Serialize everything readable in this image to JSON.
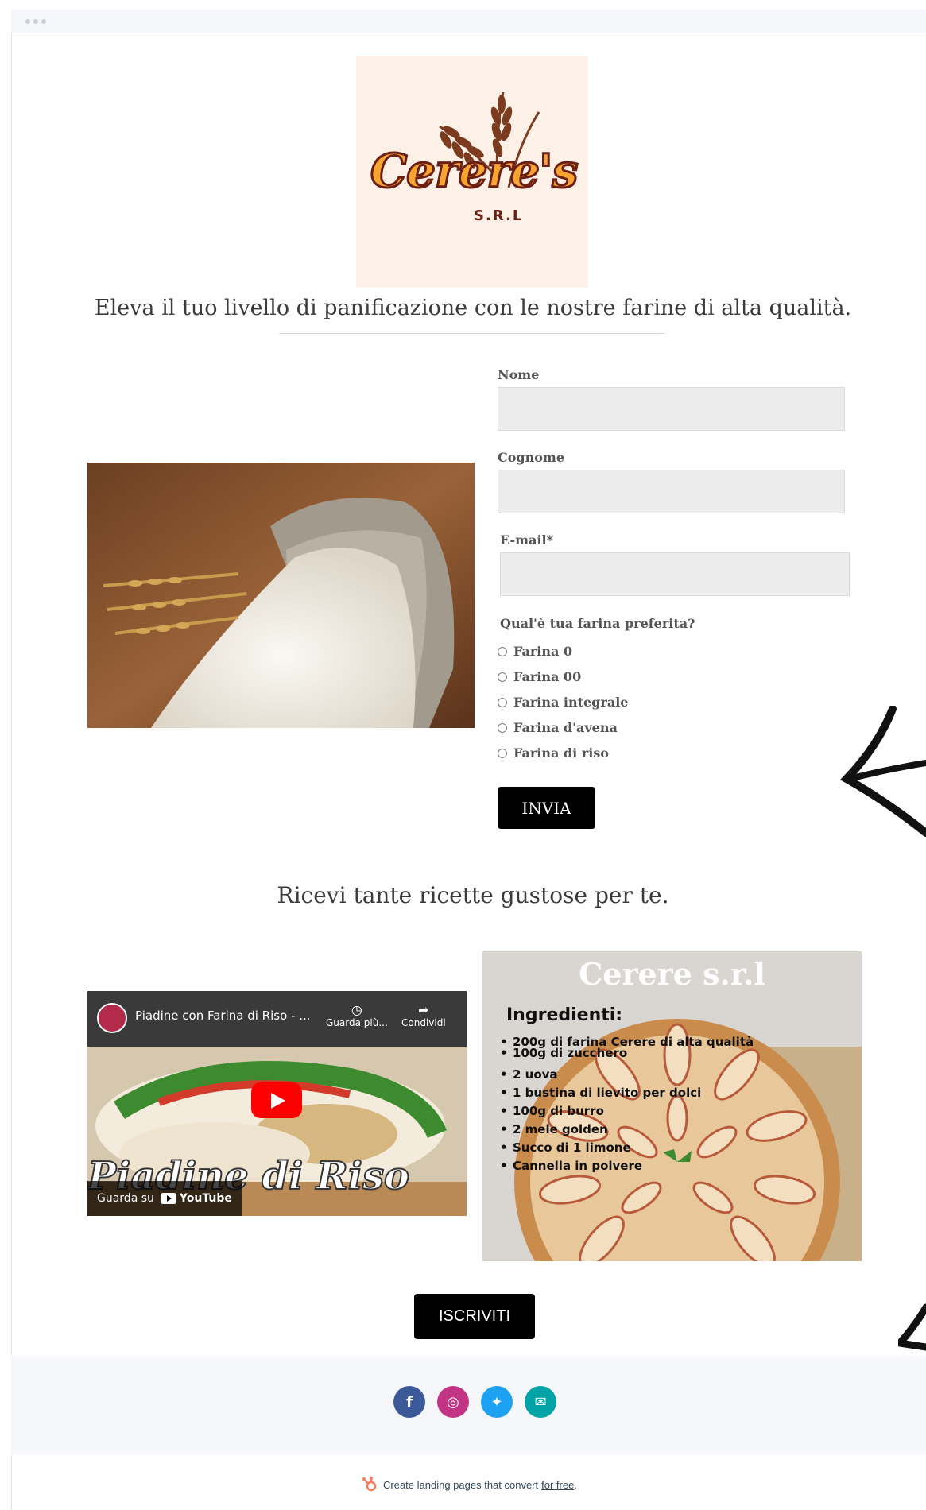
{
  "logo": {
    "brand": "Cerere's",
    "suffix": "S.R.L"
  },
  "headline": "Eleva il tuo livello di panificazione con le nostre farine di alta qualità.",
  "form": {
    "first_name_label": "Nome",
    "first_name_value": "",
    "last_name_label": "Cognome",
    "last_name_value": "",
    "email_label": "E-mail*",
    "email_value": "",
    "question": "Qual'è tua farina preferita?",
    "options": [
      "Farina 0",
      "Farina 00",
      "Farina integrale",
      "Farina d'avena",
      "Farina di riso"
    ],
    "submit_label": "INVIA"
  },
  "subheadline": "Ricevi tante ricette gustose per te.",
  "video": {
    "title": "Piadine con Farina di Riso - ...",
    "watch_later_label": "Guarda più...",
    "share_label": "Condividi",
    "overlay_text": "Piadine di Riso",
    "watch_on_label": "Guarda su",
    "platform": "YouTube"
  },
  "recipe": {
    "brand": "Cerere s.r.l",
    "heading": "Ingredienti:",
    "ingredients": [
      "200g di farina Cerere di alta qualità",
      "100g di zucchero",
      "2 uova",
      "1 bustina di lievito per dolci",
      "100g di burro",
      "2 mele golden",
      "Succo di 1 limone",
      "Cannella in polvere"
    ]
  },
  "cta_label": "ISCRIVITI",
  "socials": [
    {
      "name": "facebook",
      "glyph": "f",
      "color": "#3b5998"
    },
    {
      "name": "instagram",
      "glyph": "◎",
      "color": "#c13584"
    },
    {
      "name": "twitter",
      "glyph": "✦",
      "color": "#1da1f2"
    },
    {
      "name": "email",
      "glyph": "✉",
      "color": "#00a4a6"
    }
  ],
  "hubspot": {
    "text": "Create landing pages that convert",
    "link": "for free",
    "end": "."
  }
}
